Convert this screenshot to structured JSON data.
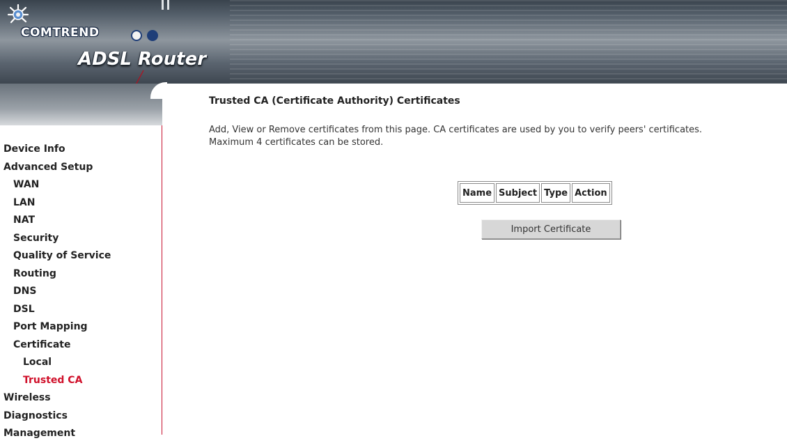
{
  "header": {
    "brand": "COMTREND",
    "product": "ADSL Router",
    "colors": {
      "header_dark": "#39434d",
      "brand_dot_1": "#f2f2f2",
      "brand_dot_2": "#1f3e78"
    },
    "logo_icon": "flower-logo-icon"
  },
  "sidebar": {
    "border_color": "#c8102e",
    "active_color": "#d0102a",
    "items": [
      {
        "label": "Device Info",
        "level": 1
      },
      {
        "label": "Advanced Setup",
        "level": 1
      },
      {
        "label": "WAN",
        "level": 2
      },
      {
        "label": "LAN",
        "level": 2
      },
      {
        "label": "NAT",
        "level": 2
      },
      {
        "label": "Security",
        "level": 2
      },
      {
        "label": "Quality of Service",
        "level": 2
      },
      {
        "label": "Routing",
        "level": 2
      },
      {
        "label": "DNS",
        "level": 2
      },
      {
        "label": "DSL",
        "level": 2
      },
      {
        "label": "Port Mapping",
        "level": 2
      },
      {
        "label": "Certificate",
        "level": 2
      },
      {
        "label": "Local",
        "level": 3
      },
      {
        "label": "Trusted CA",
        "level": 3,
        "active": true
      },
      {
        "label": "Wireless",
        "level": 1
      },
      {
        "label": "Diagnostics",
        "level": 1
      },
      {
        "label": "Management",
        "level": 1
      }
    ]
  },
  "main": {
    "title": "Trusted CA (Certificate Authority) Certificates",
    "description_line1": "Add, View or Remove certificates from this page. CA certificates are used by you to verify peers' certificates.",
    "description_line2": "Maximum 4 certificates can be stored.",
    "table": {
      "columns": [
        "Name",
        "Subject",
        "Type",
        "Action"
      ],
      "rows": []
    },
    "import_button": "Import Certificate"
  }
}
